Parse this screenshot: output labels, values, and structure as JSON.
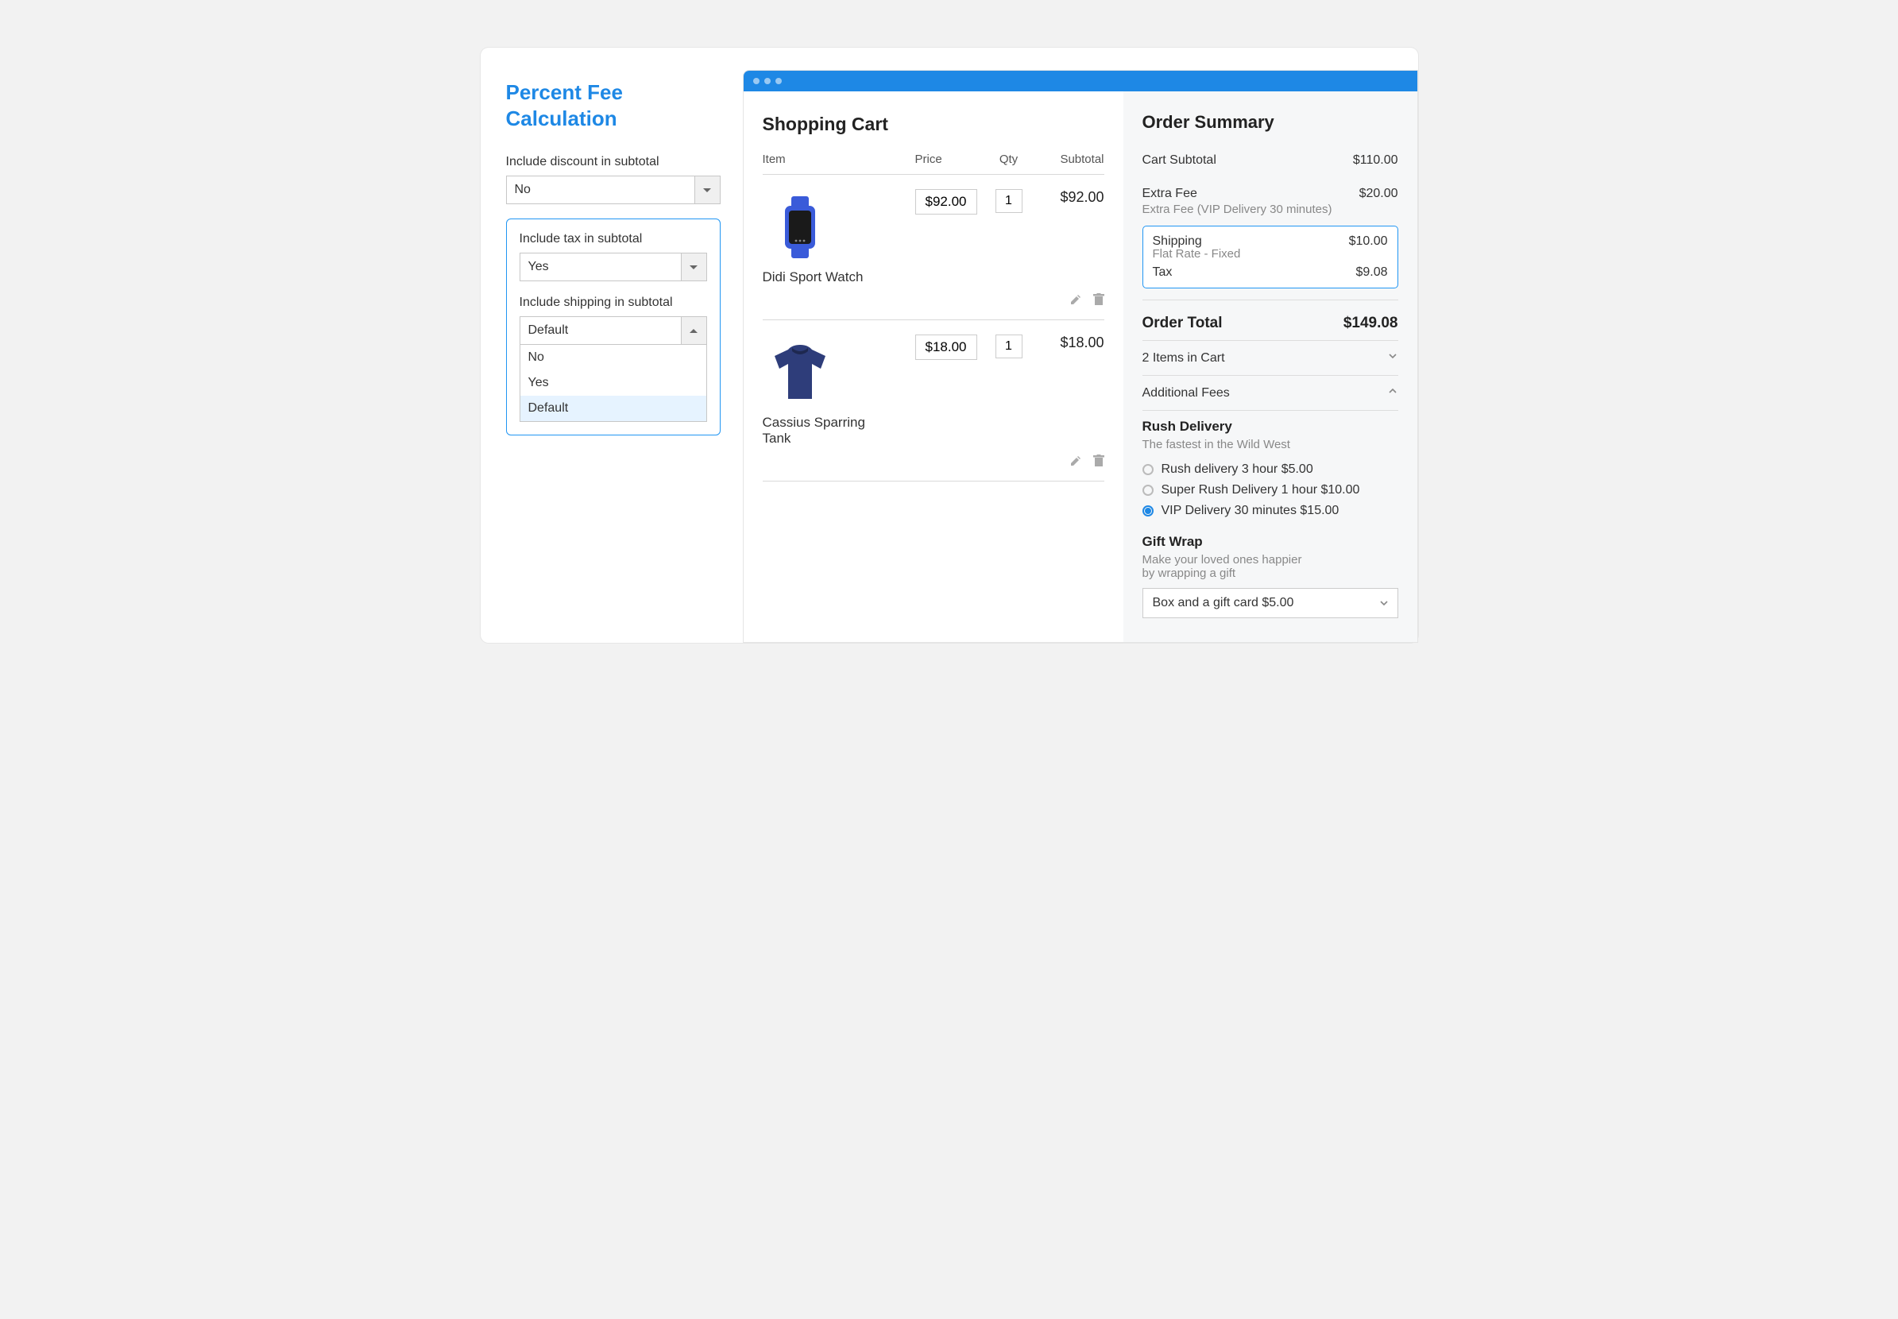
{
  "left": {
    "title": "Percent Fee Calculation",
    "discount": {
      "label": "Include discount in subtotal",
      "value": "No"
    },
    "tax": {
      "label": "Include tax in subtotal",
      "value": "Yes"
    },
    "shipping": {
      "label": "Include shipping in subtotal",
      "value": "Default",
      "options": [
        "No",
        "Yes",
        "Default"
      ]
    }
  },
  "cart": {
    "title": "Shopping Cart",
    "headers": {
      "item": "Item",
      "price": "Price",
      "qty": "Qty",
      "subtotal": "Subtotal"
    },
    "items": [
      {
        "name": "Didi Sport Watch",
        "price": "$92.00",
        "qty": "1",
        "subtotal": "$92.00"
      },
      {
        "name": "Cassius Sparring Tank",
        "price": "$18.00",
        "qty": "1",
        "subtotal": "$18.00"
      }
    ]
  },
  "summary": {
    "title": "Order Summary",
    "cart_subtotal": {
      "label": "Cart Subtotal",
      "value": "$110.00"
    },
    "extra_fee": {
      "label": "Extra Fee",
      "value": "$20.00",
      "desc": "Extra Fee (VIP Delivery 30 minutes)"
    },
    "shipping": {
      "label": "Shipping",
      "value": "$10.00",
      "desc": "Flat Rate - Fixed"
    },
    "tax": {
      "label": "Tax",
      "value": "$9.08"
    },
    "order_total": {
      "label": "Order Total",
      "value": "$149.08"
    },
    "items_in_cart": "2 Items in Cart",
    "additional_fees": "Additional Fees",
    "rush": {
      "title": "Rush Delivery",
      "desc": "The fastest in the Wild West",
      "options": [
        {
          "label": "Rush delivery 3 hour $5.00",
          "checked": false
        },
        {
          "label": "Super Rush Delivery 1 hour $10.00",
          "checked": false
        },
        {
          "label": "VIP Delivery 30 minutes $15.00",
          "checked": true
        }
      ]
    },
    "gift": {
      "title": "Gift Wrap",
      "desc": "Make your loved ones happier\nby wrapping a gift",
      "value": "Box and a gift card $5.00"
    }
  }
}
